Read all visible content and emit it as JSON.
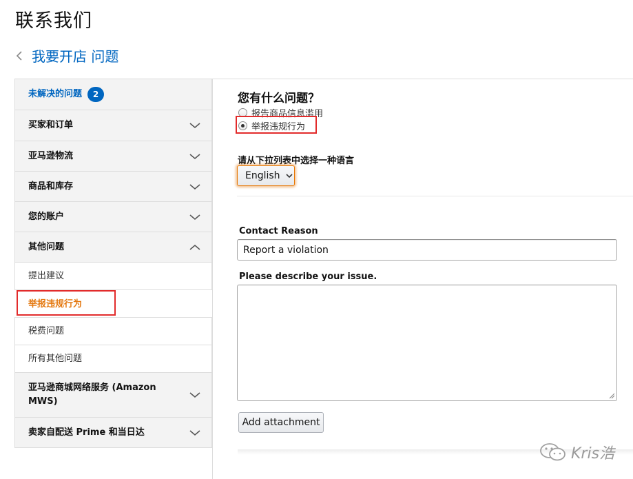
{
  "page": {
    "title": "联系我们"
  },
  "breadcrumb": {
    "text": "我要开店 问题"
  },
  "sidebar": {
    "unresolved": {
      "label": "未解决的问题",
      "badge": "2"
    },
    "items": [
      {
        "label": "买家和订单"
      },
      {
        "label": "亚马逊物流"
      },
      {
        "label": "商品和库存"
      },
      {
        "label": "您的账户"
      },
      {
        "label": "其他问题"
      }
    ],
    "sub_items": [
      {
        "label": "提出建议"
      },
      {
        "label": "举报违规行为"
      },
      {
        "label": "税费问题"
      },
      {
        "label": "所有其他问题"
      }
    ],
    "more_items": [
      {
        "label": "亚马逊商城网络服务 (Amazon MWS)"
      },
      {
        "label": "卖家自配送 Prime 和当日达"
      }
    ]
  },
  "main": {
    "question_title": "您有什么问题？",
    "radio_options": [
      {
        "label": "报告商品信息滥用",
        "checked": false
      },
      {
        "label": "举报违规行为",
        "checked": true
      }
    ],
    "language_label": "请从下拉列表中选择一种语言",
    "language_value": "English",
    "contact_reason_label": "Contact Reason",
    "contact_reason_value": "Report a violation",
    "describe_label": "Please describe your issue.",
    "describe_value": "",
    "attach_button": "Add attachment"
  },
  "watermark": {
    "text": "Kris浩"
  },
  "colors": {
    "link": "#0066c0",
    "selected": "#e47911",
    "highlight_box": "#e22b2b",
    "badge": "#0066c0"
  },
  "icons": {
    "back": "chevron-left-icon",
    "expand": "chevron-down-icon",
    "collapse": "chevron-up-icon",
    "dropdown": "caret-down-icon",
    "watermark": "wechat-icon"
  }
}
